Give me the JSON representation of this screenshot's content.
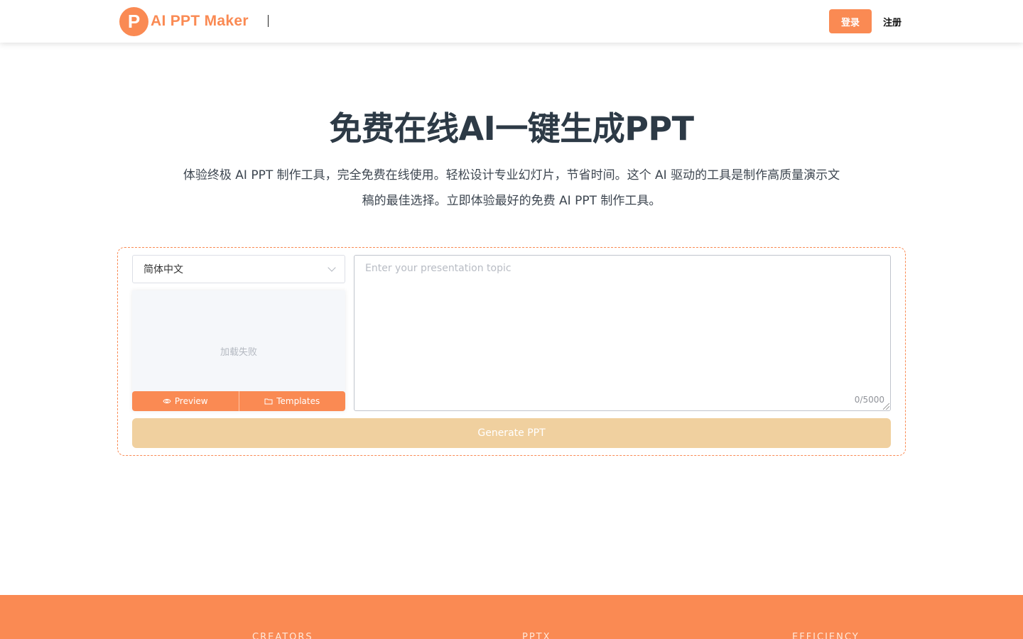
{
  "header": {
    "logo_letter": "P",
    "logo_text": "AI PPT Maker",
    "login_label": "登录",
    "register_label": "注册"
  },
  "hero": {
    "title": "免费在线AI一键生成PPT",
    "subtitle": "体验终极 AI PPT 制作工具，完全免费在线使用。轻松设计专业幻灯片，节省时间。这个 AI 驱动的工具是制作高质量演示文稿的最佳选择。立即体验最好的免费 AI PPT 制作工具。"
  },
  "generator": {
    "language_selected": "简体中文",
    "preview_status": "加载失败",
    "preview_button": "Preview",
    "templates_button": "Templates",
    "topic_placeholder": "Enter your presentation topic",
    "char_count": "0/5000",
    "generate_button": "Generate PPT"
  },
  "band": {
    "labels": [
      "CREATORS",
      "PPTX",
      "EFFICIENCY"
    ]
  },
  "colors": {
    "accent": "#fa8a53",
    "generate_disabled": "#f0d09f",
    "title_text": "#2d3a46"
  }
}
